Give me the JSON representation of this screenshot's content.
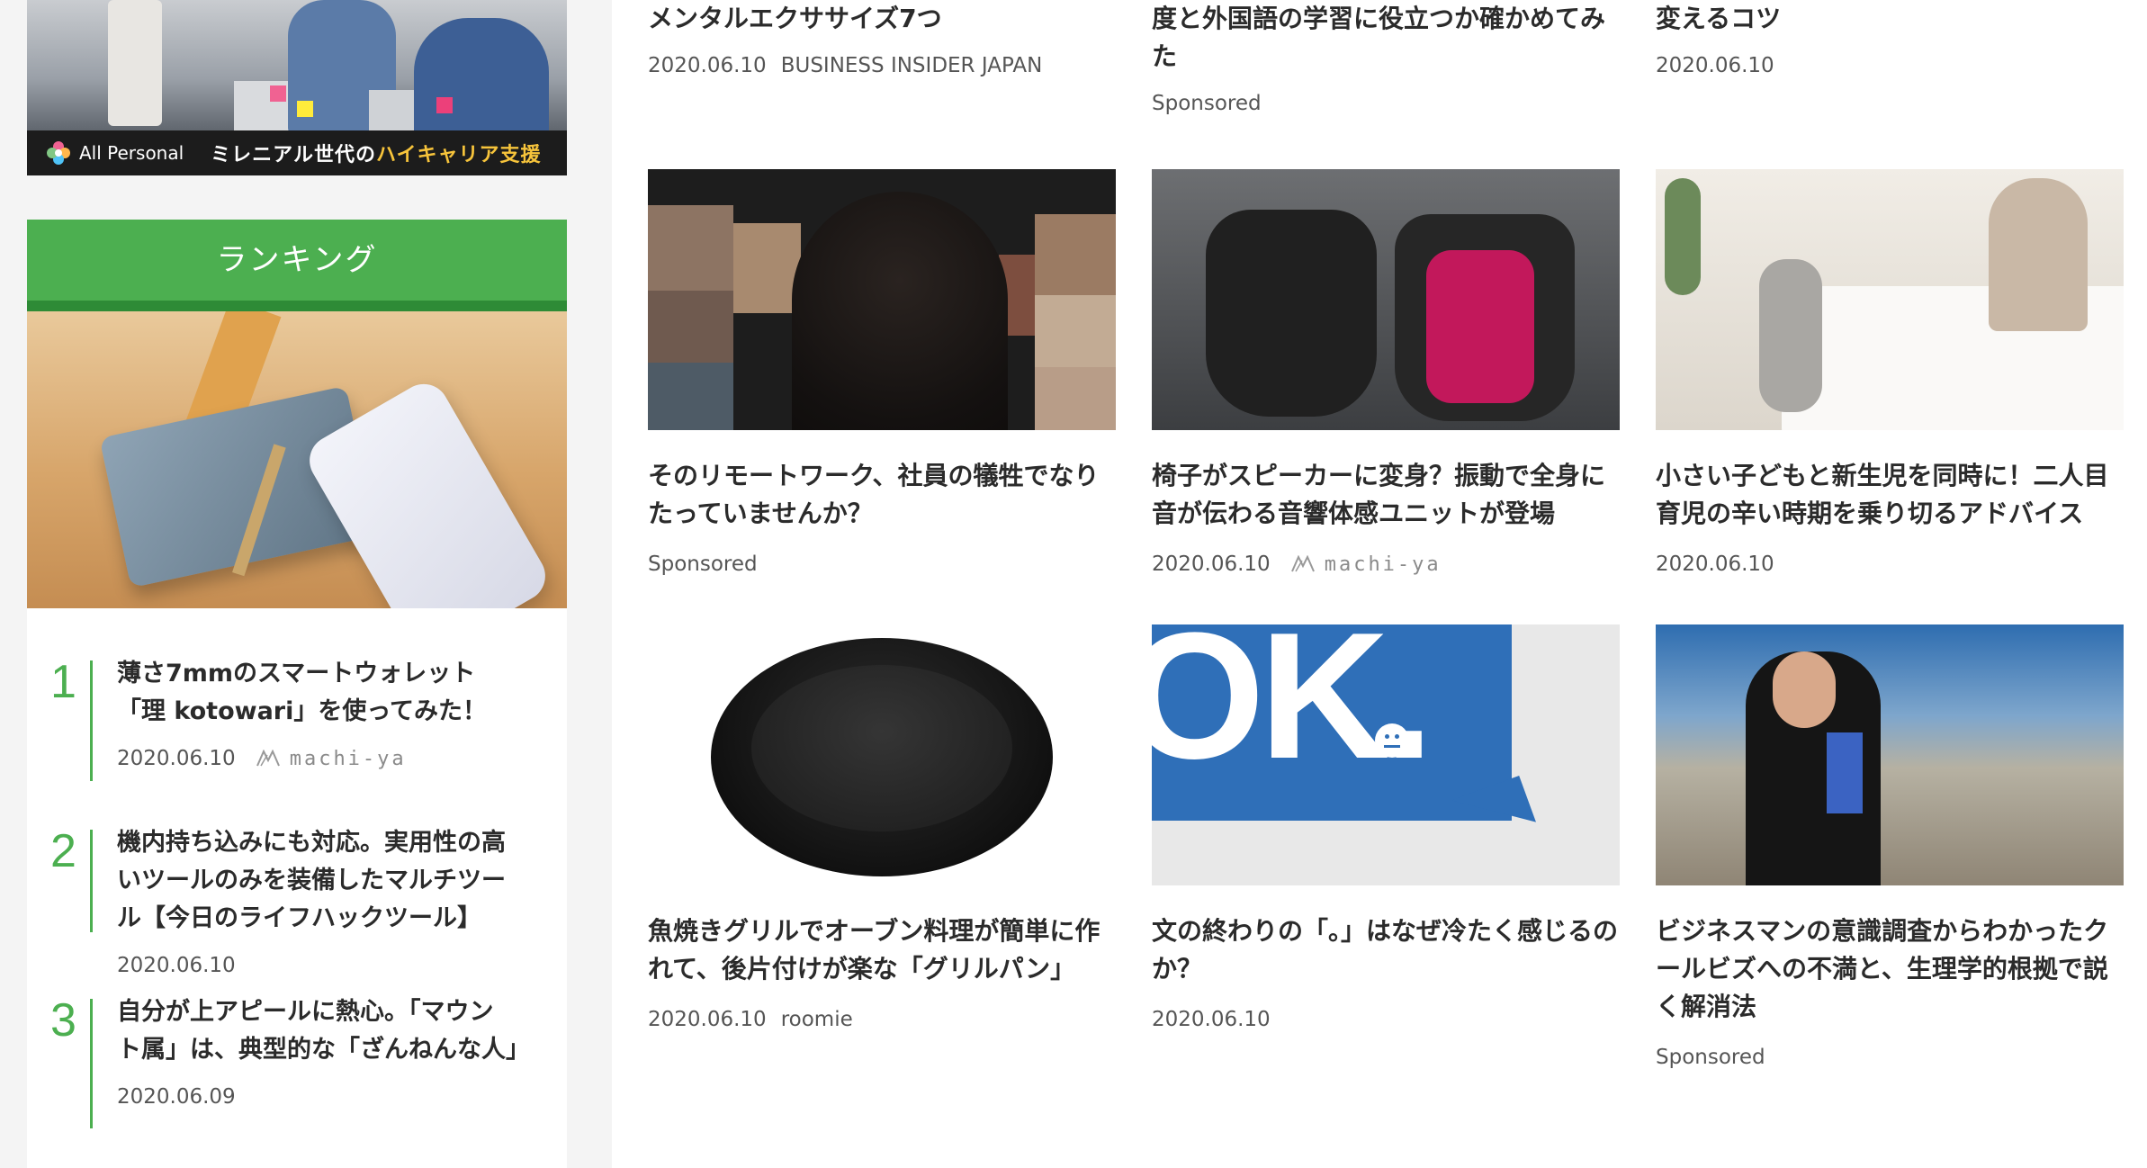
{
  "banner": {
    "logo_text": "All Personal",
    "tagline_prefix": "ミレニアル世代の",
    "tagline_highlight": "ハイキャリア支援"
  },
  "ranking": {
    "heading": "ランキング",
    "items": [
      {
        "rank": "1",
        "title_line1": "薄さ7mmのスマートウォレット",
        "title_line2": "「理 kotowari」を使ってみた！",
        "date": "2020.06.10",
        "source": "machi-ya"
      },
      {
        "rank": "2",
        "title_line1": "機内持ち込みにも対応。実用性の高",
        "title_line2": "いツールのみを装備したマルチツー",
        "title_line3": "ル【今日のライフハックツール】",
        "date": "2020.06.10"
      },
      {
        "rank": "3",
        "title_line1": "自分が上アピールに熱心。「マウン",
        "title_line2": "ト属」は、典型的な「ざんねんな人」",
        "date": "2020.06.09"
      }
    ]
  },
  "top_row": [
    {
      "title_line1": "メンタルエクササイズ7つ",
      "date": "2020.06.10",
      "source": "BUSINESS INSIDER JAPAN"
    },
    {
      "title_line1": "度と外国語の学習に役立つか確かめてみ",
      "title_line2": "た",
      "label": "Sponsored"
    },
    {
      "title_line1": "変えるコツ",
      "date": "2020.06.10"
    }
  ],
  "cards": [
    {
      "title_line1": "そのリモートワーク、社員の犠牲でなり",
      "title_line2": "たっていませんか？",
      "label": "Sponsored"
    },
    {
      "title_line1": "椅子がスピーカーに変身？振動で全身に",
      "title_line2": "音が伝わる音響体感ユニットが登場",
      "date": "2020.06.10",
      "source": "machi-ya"
    },
    {
      "title_line1": "小さい子どもと新生児を同時に！二人目",
      "title_line2": "育児の辛い時期を乗り切るアドバイス",
      "date": "2020.06.10"
    },
    {
      "title_line1": "魚焼きグリルでオーブン料理が簡単に作",
      "title_line2": "れて、後片付けが楽な「グリルパン」",
      "date": "2020.06.10",
      "source": "roomie"
    },
    {
      "title_line1": "文の終わりの「。」はなぜ冷たく感じるの",
      "title_line2": "か？",
      "date": "2020.06.10",
      "image_text": "OK."
    },
    {
      "title_line1": "ビジネスマンの意識調査からわかったク",
      "title_line2": "ールビズへの不満と、生理学的根拠で説",
      "title_line3": "く解消法",
      "label": "Sponsored"
    }
  ],
  "colors": {
    "accent_green": "#4caf50",
    "accent_green_dark": "#2e8b36",
    "highlight_yellow": "#f7c43b"
  }
}
